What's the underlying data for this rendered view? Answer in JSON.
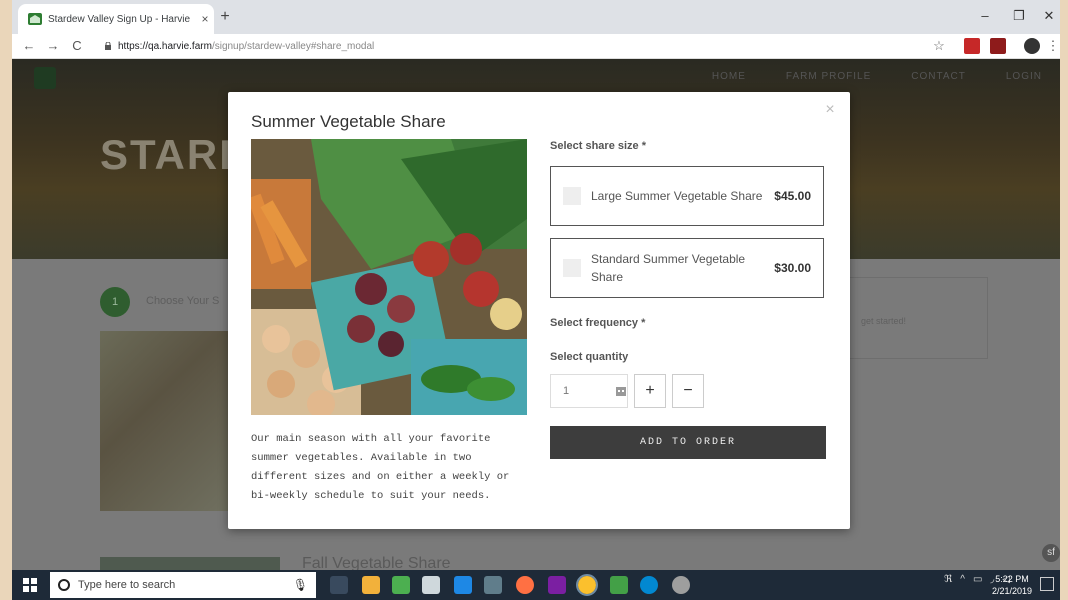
{
  "browser": {
    "tab_title": "Stardew Valley Sign Up - Harvie",
    "tab_close": "×",
    "new_tab": "+",
    "url_host": "https://qa.harvie.farm",
    "url_path": "/signup/stardew-valley#share_modal",
    "window": {
      "minimize": "–",
      "restore": "❐",
      "close": "✕"
    },
    "nav": {
      "back": "←",
      "forward": "→",
      "reload": "C"
    },
    "star": "☆",
    "menu": "⋮"
  },
  "site": {
    "nav": [
      "HOME",
      "FARM PROFILE",
      "CONTACT",
      "LOGIN"
    ],
    "hero_title": "STARD",
    "step_number": "1",
    "step_text": "Choose Your S",
    "right_box_text": "get started!",
    "bottom_title": "Fall Vegetable Share"
  },
  "modal": {
    "title": "Summer Vegetable Share",
    "close": "×",
    "description": "Our main season with all your favorite summer vegetables. Available in two different sizes and on either a weekly or bi-weekly schedule to suit your needs.",
    "size_label": "Select share size *",
    "options": [
      {
        "name": "Large Summer Vegetable Share",
        "price": "$45.00"
      },
      {
        "name": "Standard Summer Vegetable Share",
        "price": "$30.00"
      }
    ],
    "frequency_label": "Select frequency *",
    "quantity_label": "Select quantity",
    "quantity_value": "1",
    "plus": "+",
    "minus": "−",
    "add_button": "ADD TO ORDER"
  },
  "taskbar": {
    "search_placeholder": "Type here to search",
    "time": "5:22 PM",
    "date": "2/21/2019"
  }
}
